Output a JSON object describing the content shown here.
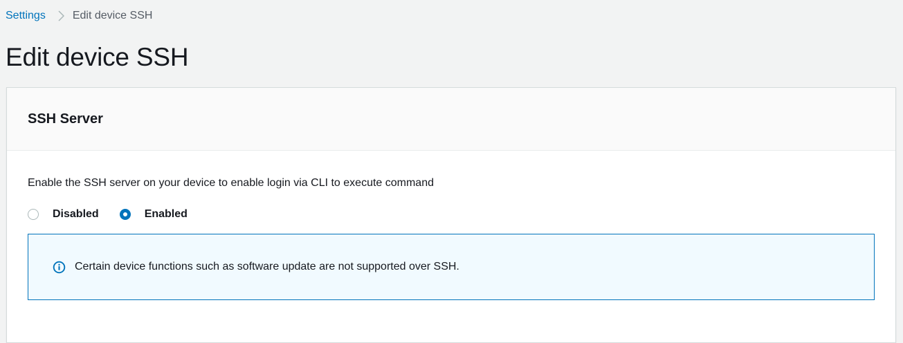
{
  "breadcrumb": {
    "items": [
      "Settings",
      "Edit device SSH"
    ]
  },
  "page": {
    "title": "Edit device SSH"
  },
  "panel": {
    "title": "SSH Server",
    "description": "Enable the SSH server on your device to enable login via CLI to execute command",
    "radio_options": [
      {
        "label": "Disabled",
        "selected": false
      },
      {
        "label": "Enabled",
        "selected": true
      }
    ],
    "alert": {
      "icon": "info-icon",
      "text": "Certain device functions such as software update are not supported over SSH."
    }
  },
  "colors": {
    "accent": "#0073bb",
    "alert_background": "#f1faff",
    "page_background": "#f2f3f3"
  }
}
